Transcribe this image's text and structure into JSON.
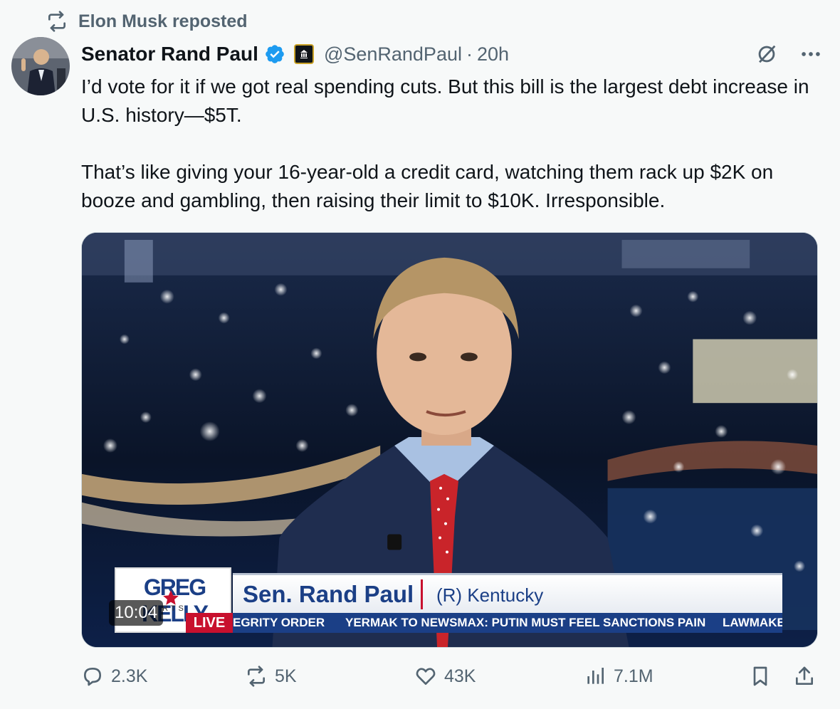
{
  "repost": {
    "text": "Elon Musk reposted"
  },
  "author": {
    "name": "Senator Rand Paul",
    "handle": "@SenRandPaul",
    "separator": "·",
    "time": "20h"
  },
  "tweet": {
    "paragraph1": "I’d vote for it if we got real spending cuts. But this bill is the largest debt increase in U.S. history—$5T.",
    "paragraph2": "That’s like giving your 16-year-old a credit card, watching them rack up $2K on booze and gambling, then raising their limit to $10K. Irresponsible."
  },
  "video": {
    "duration": "10:04",
    "logo_text": "GREG KELLY",
    "logo_sub": "RTS",
    "live_label": "LIVE",
    "name_main": "Sen. Rand Paul",
    "name_state": "(R) Kentucky",
    "ticker": [
      "EGRITY ORDER",
      "YERMAK TO NEWSMAX: PUTIN MUST FEEL SANCTIONS PAIN",
      "LAWMAKE"
    ]
  },
  "actions": {
    "replies": "2.3K",
    "reposts": "5K",
    "likes": "43K",
    "views": "7.1M"
  },
  "icons": {
    "repost": "repost-icon",
    "verified": "verified-badge-icon",
    "gov": "government-badge-icon",
    "grok": "grok-icon",
    "more": "more-icon",
    "reply": "reply-icon",
    "like": "heart-icon",
    "views": "views-icon",
    "bookmark": "bookmark-icon",
    "share": "share-icon"
  },
  "colors": {
    "verified": "#1d9bf0",
    "text": "#0f1419",
    "muted": "#536471",
    "background": "#f7f9f9"
  }
}
